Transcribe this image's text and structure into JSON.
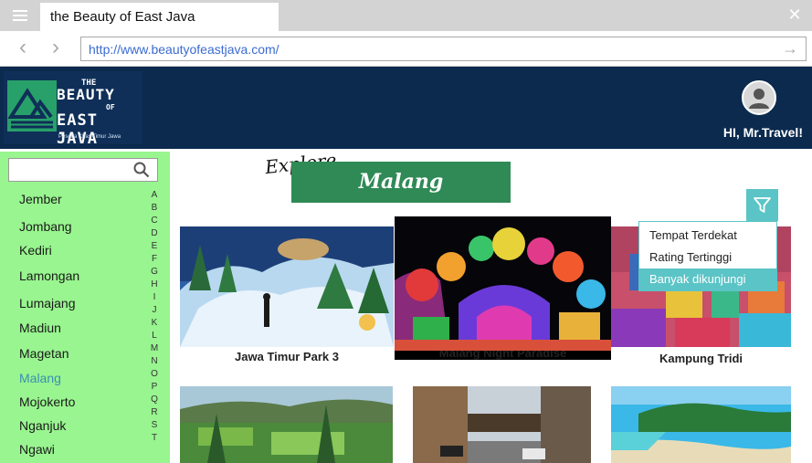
{
  "browser": {
    "tab_title": "the Beauty of East Java",
    "url": "http://www.beautyofeastjava.com/"
  },
  "header": {
    "logo": {
      "line1": "THE",
      "line2": "BEAUTY",
      "line3": "OF",
      "line4": "EAST JAVA",
      "tagline": "Pesona Khas Timur Jawa"
    },
    "greeting": "HI, Mr.Travel!"
  },
  "sidebar": {
    "search_placeholder": "",
    "cities": [
      "Jember",
      "Jombang",
      "Kediri",
      "Lamongan",
      "Lumajang",
      "Madiun",
      "Magetan",
      "Malang",
      "Mojokerto",
      "Nganjuk",
      "Ngawi"
    ],
    "active_city": "Malang",
    "alphabet": [
      "A",
      "B",
      "C",
      "D",
      "E",
      "F",
      "G",
      "H",
      "I",
      "J",
      "K",
      "L",
      "M",
      "N",
      "O",
      "P",
      "Q",
      "R",
      "S",
      "T"
    ]
  },
  "main": {
    "explore_label": "Explore",
    "city_title": "Malang",
    "filter": {
      "options": [
        "Tempat Terdekat",
        "Rating Tertinggi",
        "Banyak dikunjungi"
      ],
      "selected": "Banyak dikunjungi"
    },
    "cards": [
      {
        "label": "Jawa Timur Park 3"
      },
      {
        "label": "Malang Night Paradise"
      },
      {
        "label": "Kampung Tridi"
      },
      {
        "label": ""
      },
      {
        "label": ""
      },
      {
        "label": ""
      }
    ]
  },
  "colors": {
    "header_bg": "#0b2a4e",
    "sidebar_bg": "#98f58f",
    "banner_bg": "#2f8a56",
    "accent": "#5bc4c6",
    "active_city": "#3c8fb0"
  }
}
